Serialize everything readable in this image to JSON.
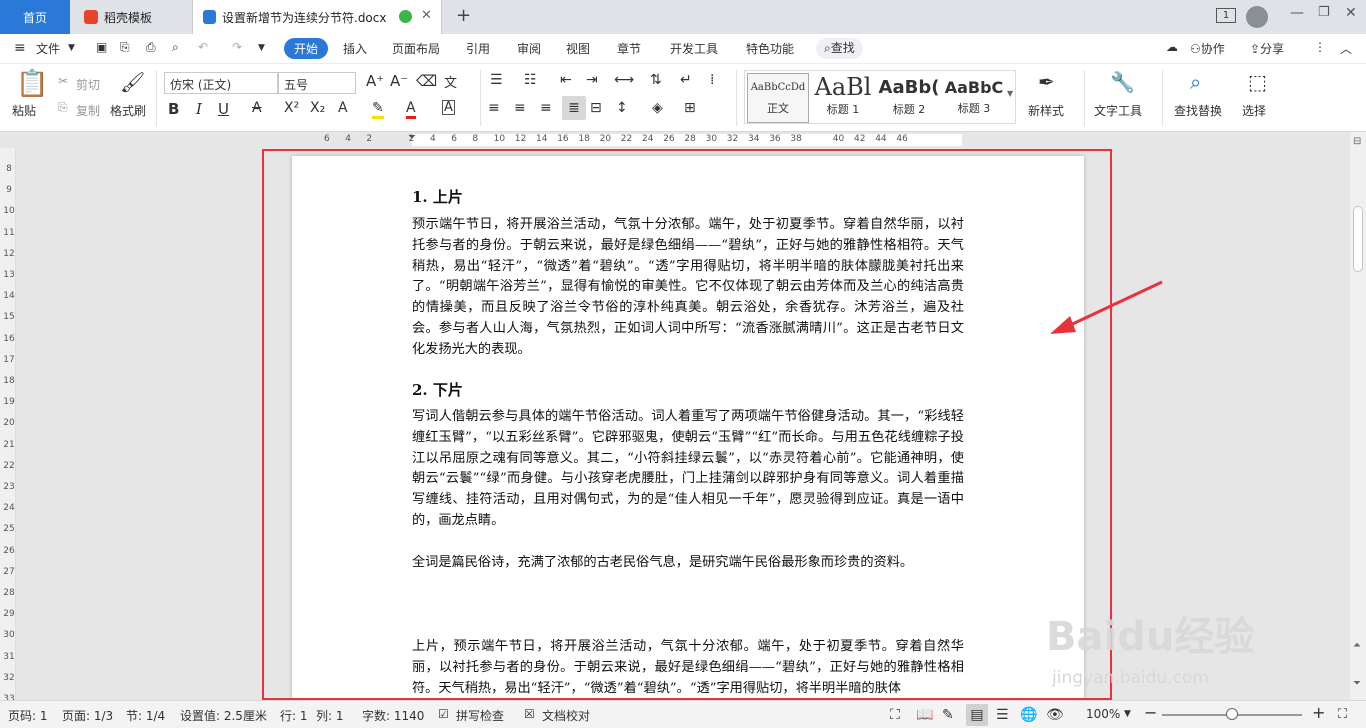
{
  "tabs": {
    "home": "首页",
    "daoke": "稻壳模板",
    "doc": "设置新增节为连续分节符.docx",
    "new_tab": "+",
    "page_count_badge": "1"
  },
  "menu": {
    "file": "文件",
    "items": [
      "开始",
      "插入",
      "页面布局",
      "引用",
      "审阅",
      "视图",
      "章节",
      "开发工具",
      "特色功能"
    ],
    "search": "查找",
    "collab": "协作",
    "share": "分享"
  },
  "toolbar": {
    "paste": "粘贴",
    "cut": "剪切",
    "copy": "复制",
    "format_painter": "格式刷",
    "font_name": "仿宋 (正文)",
    "font_size": "五号",
    "styles": [
      {
        "preview": "AaBbCcDd",
        "label": "正文"
      },
      {
        "preview": "AaBl",
        "label": "标题 1"
      },
      {
        "preview": "AaBb(",
        "label": "标题 2"
      },
      {
        "preview": "AaBbC",
        "label": "标题 3"
      }
    ],
    "new_style": "新样式",
    "text_tools": "文字工具",
    "find_replace": "查找替换",
    "select": "选择"
  },
  "ruler": {
    "ticks": [
      "6",
      "4",
      "2",
      "",
      "2",
      "4",
      "6",
      "8",
      "10",
      "12",
      "14",
      "16",
      "18",
      "20",
      "22",
      "24",
      "26",
      "28",
      "30",
      "32",
      "34",
      "36",
      "38",
      "",
      "40",
      "42",
      "44",
      "46"
    ],
    "vticks": [
      "8",
      "9",
      "10",
      "11",
      "12",
      "13",
      "14",
      "15",
      "16",
      "17",
      "18",
      "19",
      "20",
      "21",
      "22",
      "23",
      "24",
      "25",
      "26",
      "27",
      "28",
      "29",
      "30",
      "31",
      "32",
      "33"
    ]
  },
  "document": {
    "h1": "1.  上片",
    "p1": "预示端午节日，将开展浴兰活动，气氛十分浓郁。端午，处于初夏季节。穿着自然华丽，以衬托参与者的身份。于朝云来说，最好是绿色细绢——“碧纨”，正好与她的雅静性格相符。天气稍热，易出“轻汗”，“微透”着“碧纨”。“透”字用得贴切，将半明半暗的肤体朦胧美衬托出来了。“明朝端午浴芳兰”，显得有愉悦的审美性。它不仅体现了朝云由芳体而及兰心的纯洁高贵的情操美，而且反映了浴兰令节俗的淳朴纯真美。朝云浴处，余香犹存。沐芳浴兰，遍及社会。参与者人山人海，气氛热烈，正如词人词中所写：“流香涨腻满晴川”。这正是古老节日文化发扬光大的表现。",
    "h2": "2.  下片",
    "p2": "写词人偕朝云参与具体的端午节俗活动。词人着重写了两项端午节俗健身活动。其一，“彩线轻缠红玉臂”，“以五彩丝系臂”。它辟邪驱鬼，使朝云“玉臂”“红”而长命。与用五色花线缠粽子投江以吊屈原之魂有同等意义。其二，“小符斜挂绿云鬟”，以“赤灵符着心前”。它能通神明，使朝云“云鬟”“绿”而身健。与小孩穿老虎腰肚，门上挂蒲剑以辟邪护身有同等意义。词人着重描写缠线、挂符活动，且用对偶句式，为的是“佳人相见一千年”，愿灵验得到应证。真是一语中的，画龙点睛。",
    "p3": "全词是篇民俗诗，充满了浓郁的古老民俗气息，是研究端午民俗最形象而珍贵的资料。",
    "p4": "上片，预示端午节日，将开展浴兰活动，气氛十分浓郁。端午，处于初夏季节。穿着自然华丽，以衬托参与者的身份。于朝云来说，最好是绿色细绢——“碧纨”，正好与她的雅静性格相符。天气稍热，易出“轻汗”，“微透”着“碧纨”。“透”字用得贴切，将半明半暗的肤体"
  },
  "status": {
    "page_no": "页码: 1",
    "pages": "页面: 1/3",
    "section": "节: 1/4",
    "setting": "设置值: 2.5厘米",
    "row": "行: 1",
    "col": "列: 1",
    "wordcount": "字数: 1140",
    "spellcheck": "拼写检查",
    "proofread": "文档校对",
    "zoom": "100%"
  },
  "watermark": {
    "brand": "Baidu经验",
    "url": "jingyan.baidu.com"
  },
  "colors": {
    "accent": "#2a78d8",
    "highlight_frame": "#e8323c",
    "arrow": "#e8323c"
  }
}
